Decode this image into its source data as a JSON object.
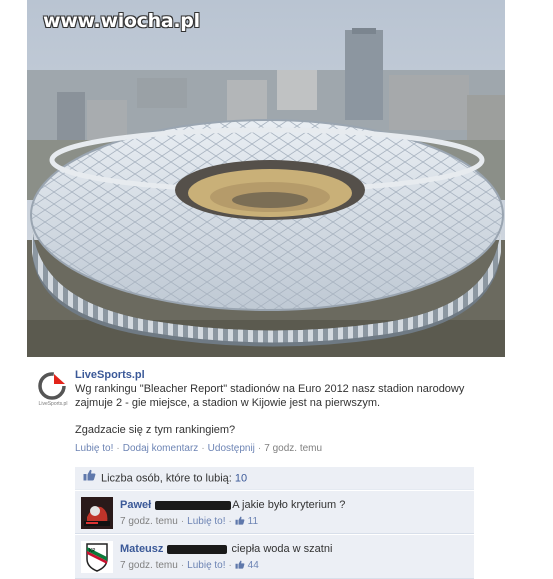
{
  "watermark": "www.wiocha.pl",
  "post": {
    "page_name": "LiveSports.pl",
    "avatar_caption": "LiveSports.pl",
    "text": "Wg rankingu \"Bleacher Report\" stadionów na Euro 2012 nasz stadion narodowy zajmuje 2 - gie miejsce, a stadion w Kijowie jest na pierwszym.",
    "question": "Zgadzacie się z tym rankingiem?",
    "actions": {
      "like": "Lubię to!",
      "comment": "Dodaj komentarz",
      "share": "Udostępnij",
      "time": "7 godz. temu"
    }
  },
  "likes": {
    "label": "Liczba osób, które to lubią:",
    "count": "10"
  },
  "comments": [
    {
      "author": "Paweł",
      "text": "A jakie było kryterium ?",
      "time": "7 godz. temu",
      "like": "Lubię to!",
      "likes": "11"
    },
    {
      "author": "Mateusz",
      "text": "ciepła woda w szatni",
      "time": "7 godz. temu",
      "like": "Lubię to!",
      "likes": "44"
    }
  ],
  "colors": {
    "link": "#3b5998",
    "link_light": "#6d84b4",
    "comment_bg": "#eceff5",
    "censor": "#1a1a1a"
  },
  "icons": {
    "like": "thumbs-up-icon",
    "page_logo": "livesports-logo-icon"
  }
}
